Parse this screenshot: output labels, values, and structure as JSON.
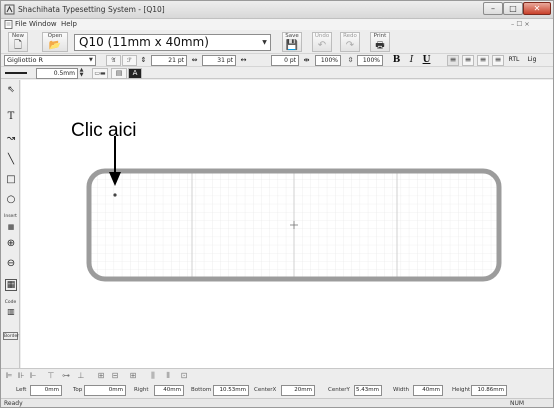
{
  "window": {
    "title": "Shachihata Typesetting System - [Q10]",
    "minimize": "–",
    "maximize": "□",
    "close": "✕"
  },
  "menu": {
    "items": [
      "File",
      "Window",
      "Help"
    ],
    "mdi_controls": "– ☐ ×"
  },
  "toolbar": {
    "new_label": "New",
    "open_label": "Open",
    "label_type": "Q10 (11mm x 40mm)",
    "save_label": "Save",
    "undo_label": "Undo",
    "redo_label": "Redo",
    "print_label": "Print"
  },
  "format_bar": {
    "font": "Gigliottio R",
    "height_a": "21 pt",
    "height_b": "31 pt",
    "char_spacing": "0 pt",
    "width_pct": "100%",
    "height_pct": "100%",
    "bold": "B",
    "italic": "I",
    "underline": "U",
    "rtl": "RTL",
    "lig": "Lig"
  },
  "line_bar": {
    "width": "0.5mm"
  },
  "palette": {
    "insert_label": "Insert",
    "barcode_label": "Code",
    "border_label": "Border"
  },
  "annotation": {
    "text": "Clic aici"
  },
  "position_bar": {
    "left_label": "Left",
    "left_value": "0mm",
    "top_label": "Top",
    "top_value": "0mm",
    "right_label": "Right",
    "right_value": "40mm",
    "bottom_label": "Bottom",
    "bottom_value": "10.53mm",
    "centerx_label": "CenterX",
    "centerx_value": "20mm",
    "centery_label": "CenterY",
    "centery_value": "5.43mm",
    "width_label": "Width",
    "width_value": "40mm",
    "height_label": "Height",
    "height_value": "10.86mm"
  },
  "status": {
    "ready": "Ready",
    "num": "NUM"
  },
  "colors": {
    "label_border": "#9c9c9c",
    "grid": "#dcdcdc",
    "canvas": "#ffffff"
  }
}
